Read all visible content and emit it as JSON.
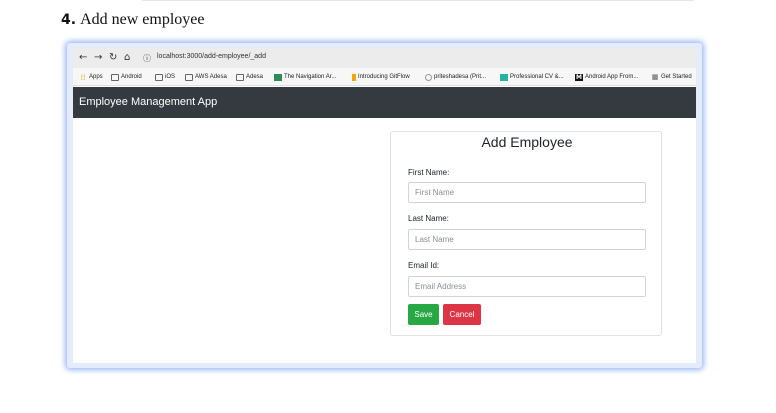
{
  "step": {
    "number": "4.",
    "title": "Add new employee"
  },
  "browser": {
    "url": "localhost:3000/add-employee/_add",
    "icons": [
      "back-arrow-icon",
      "forward-arrow-icon",
      "reload-icon",
      "home-icon",
      "info-icon"
    ],
    "bookmarks": [
      {
        "label": "Apps",
        "icon": "apps-grid-icon"
      },
      {
        "label": "Android",
        "icon": "folder-icon"
      },
      {
        "label": "iOS",
        "icon": "folder-icon"
      },
      {
        "label": "AWS Adesa",
        "icon": "folder-icon"
      },
      {
        "label": "Adesa",
        "icon": "folder-icon"
      },
      {
        "label": "The Navigation Ar...",
        "icon": "site-favicon"
      },
      {
        "label": "Introducing GitFlow",
        "icon": "site-favicon"
      },
      {
        "label": "priteshadesa (Prit...",
        "icon": "github-icon"
      },
      {
        "label": "Professional CV &...",
        "icon": "site-favicon"
      },
      {
        "label": "Android App From...",
        "icon": "medium-icon"
      },
      {
        "label": "Get Started",
        "icon": "site-favicon"
      }
    ]
  },
  "app": {
    "brand": "Employee Management App",
    "colors": {
      "navbar": "#343a40",
      "save": "#28a745",
      "cancel": "#dc3545"
    }
  },
  "form": {
    "title": "Add Employee",
    "fields": [
      {
        "label": "First Name:",
        "placeholder": "First Name"
      },
      {
        "label": "Last Name:",
        "placeholder": "Last Name"
      },
      {
        "label": "Email Id:",
        "placeholder": "Email Address"
      }
    ],
    "save_label": "Save",
    "cancel_label": "Cancel"
  }
}
